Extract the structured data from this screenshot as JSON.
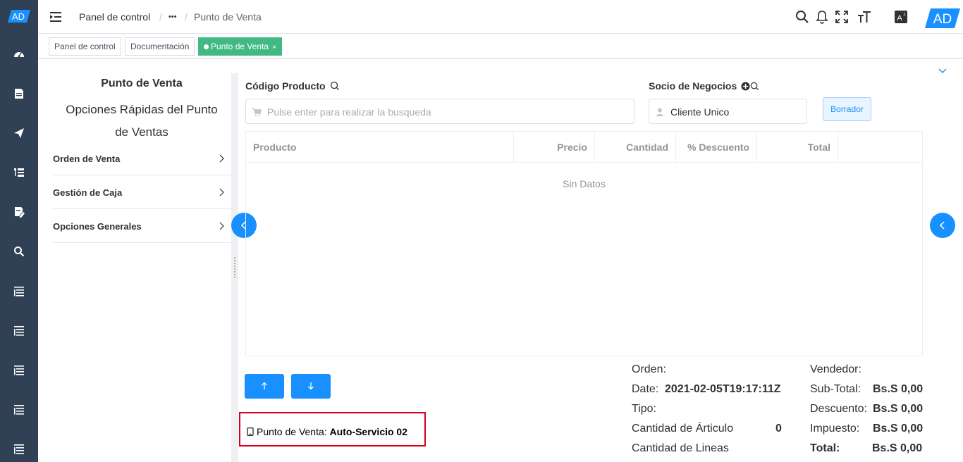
{
  "brand": {
    "logo_text": "AD",
    "accent": "#1890ff",
    "sidebar_bg": "#304156",
    "tag_active": "#42b983"
  },
  "sidebar": {
    "items": [
      {
        "icon": "dashboard-icon"
      },
      {
        "icon": "document-icon"
      },
      {
        "icon": "send-icon"
      },
      {
        "icon": "list-tree-icon"
      },
      {
        "icon": "edit-document-icon"
      },
      {
        "icon": "search-icon"
      },
      {
        "icon": "list-icon"
      },
      {
        "icon": "list-icon"
      },
      {
        "icon": "list-icon"
      },
      {
        "icon": "list-icon"
      },
      {
        "icon": "list-icon"
      }
    ]
  },
  "breadcrumb": {
    "home": "Panel de control",
    "sep": "/",
    "ellipsis": "•••",
    "current": "Punto de Venta"
  },
  "tags": [
    {
      "label": "Panel de control",
      "active": false
    },
    {
      "label": "Documentación",
      "active": false
    },
    {
      "label": "Punto de Venta",
      "active": true,
      "close": "×"
    }
  ],
  "left_panel": {
    "title": "Punto de Venta",
    "subtitle": "Opciones Rápidas del Punto de Ventas",
    "menu": [
      "Orden de Venta",
      "Gestión de Caja",
      "Opciones Generales"
    ]
  },
  "form": {
    "product_label": "Código Producto",
    "product_placeholder": "Pulse enter para realizar la busqueda",
    "partner_label": "Socio de Negocios",
    "partner_value": "Cliente Unico",
    "clear_button": "Borrador"
  },
  "table": {
    "columns": [
      "Producto",
      "Precio",
      "Cantidad",
      "% Descuento",
      "Total"
    ],
    "empty_text": "Sin Datos"
  },
  "pos": {
    "label": "Punto de Venta:",
    "value": "Auto-Servicio 02"
  },
  "summary": {
    "order_label": "Orden:",
    "date_label": "Date:",
    "date_value": "2021-02-05T19:17:11Z",
    "type_label": "Tipo:",
    "item_qty_label": "Cantidad de Árticulo",
    "item_qty_value": "0",
    "lines_label": "Cantidad de Lineas",
    "seller_label": "Vendedor:",
    "subtotal_label": "Sub-Total:",
    "subtotal_value": "Bs.S 0,00",
    "discount_label": "Descuento:",
    "discount_value": "Bs.S 0,00",
    "tax_label": "Impuesto:",
    "tax_value": "Bs.S 0,00",
    "total_label": "Total:",
    "total_value": "Bs.S 0,00"
  }
}
